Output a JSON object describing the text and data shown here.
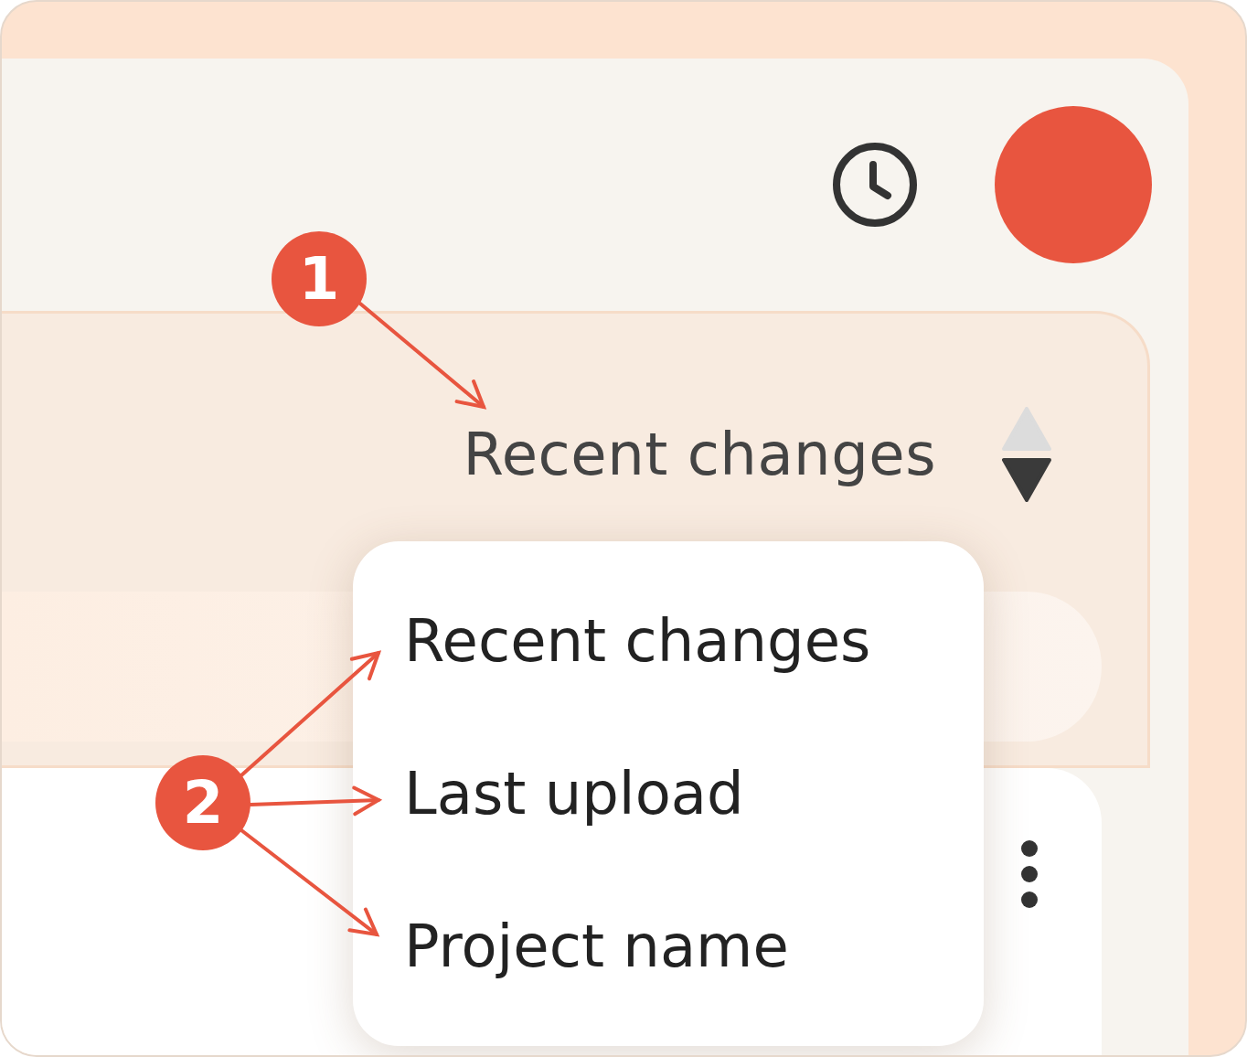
{
  "sort": {
    "label": "Recent changes",
    "descending": true
  },
  "dropdown": {
    "items": [
      {
        "label": "Recent changes"
      },
      {
        "label": "Last upload"
      },
      {
        "label": "Project name"
      }
    ]
  },
  "annotations": [
    {
      "number": "1"
    },
    {
      "number": "2"
    }
  ]
}
